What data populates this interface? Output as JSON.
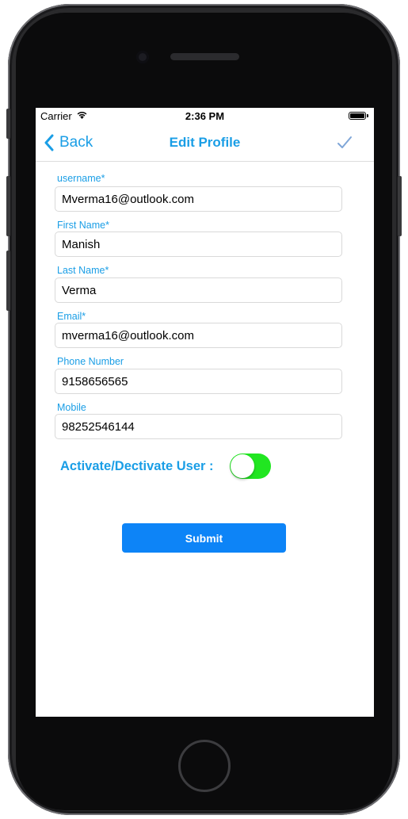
{
  "status_bar": {
    "carrier": "Carrier",
    "time": "2:36 PM"
  },
  "nav": {
    "back_label": "Back",
    "title": "Edit Profile"
  },
  "form": {
    "fields": [
      {
        "label": "username*",
        "value": "Mverma16@outlook.com"
      },
      {
        "label": "First Name*",
        "value": "Manish"
      },
      {
        "label": "Last Name*",
        "value": "Verma"
      },
      {
        "label": "Email*",
        "value": "mverma16@outlook.com"
      },
      {
        "label": "Phone Number",
        "value": "9158656565"
      },
      {
        "label": "Mobile",
        "value": "98252546144"
      }
    ],
    "toggle_label": "Activate/Dectivate User :",
    "toggle_on": true,
    "submit_label": "Submit"
  },
  "colors": {
    "accent": "#1a9ee6",
    "toggle_on": "#21e621",
    "submit_bg": "#0d84f7"
  },
  "icons": [
    "wifi-icon",
    "battery-icon",
    "back-chevron-icon",
    "checkmark-icon"
  ]
}
